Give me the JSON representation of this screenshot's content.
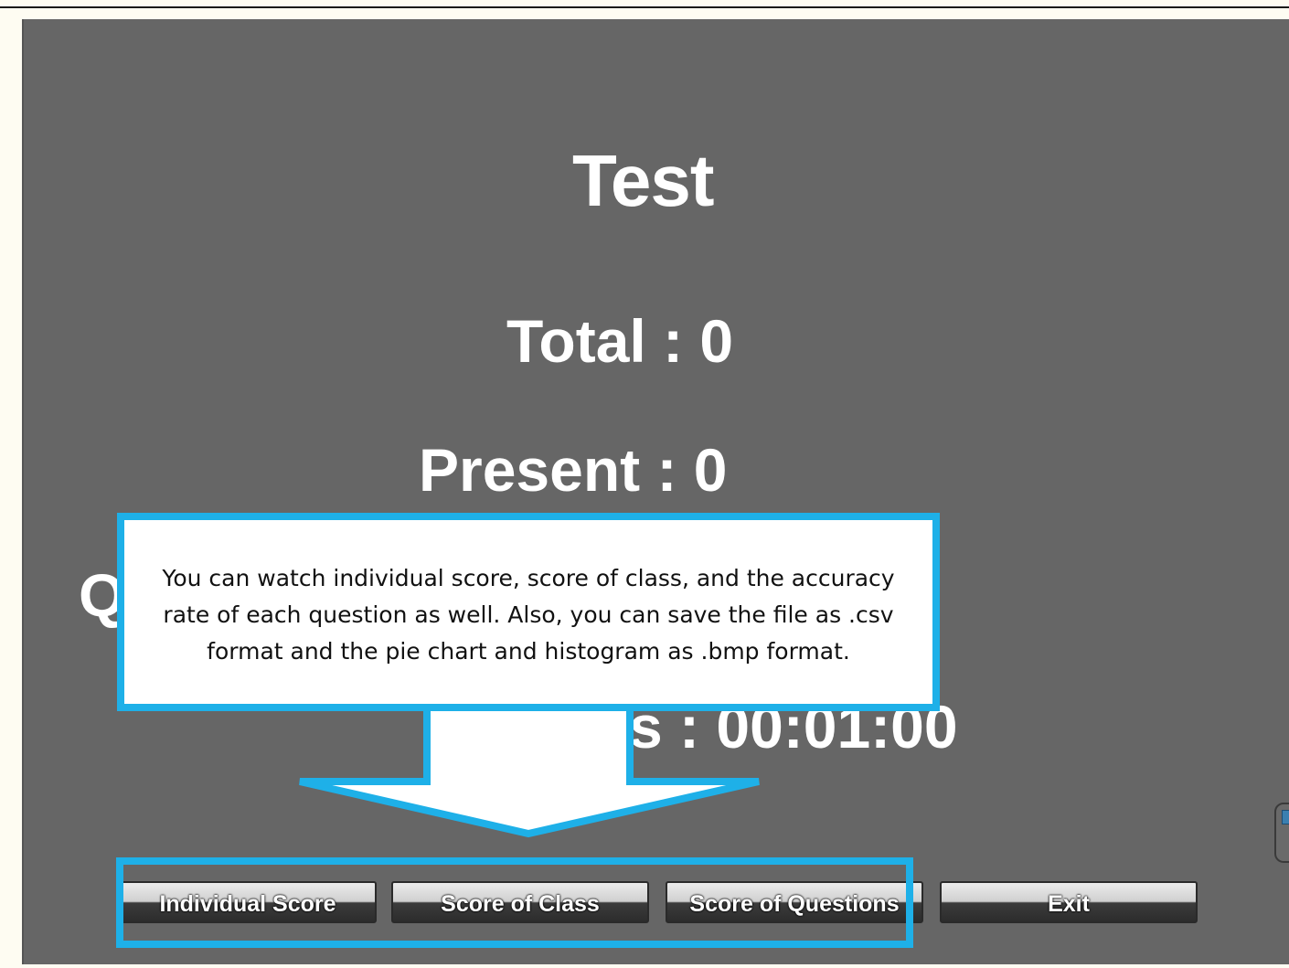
{
  "screen": {
    "title": "Test",
    "total": "Total : 0",
    "present": "Present : 0",
    "partial_label": "Q",
    "time_partial": "s : 00:01:00"
  },
  "callout": {
    "text": "You can watch individual score, score of class, and the accuracy rate of each question as well. Also, you can save the file as .csv format and the pie chart and histogram as .bmp format."
  },
  "buttons": {
    "individual": "Individual Score",
    "class": "Score of Class",
    "questions": "Score of Questions",
    "exit": "Exit"
  },
  "colors": {
    "panel": "#666666",
    "accent": "#1eb0e8",
    "text": "#ffffff"
  }
}
